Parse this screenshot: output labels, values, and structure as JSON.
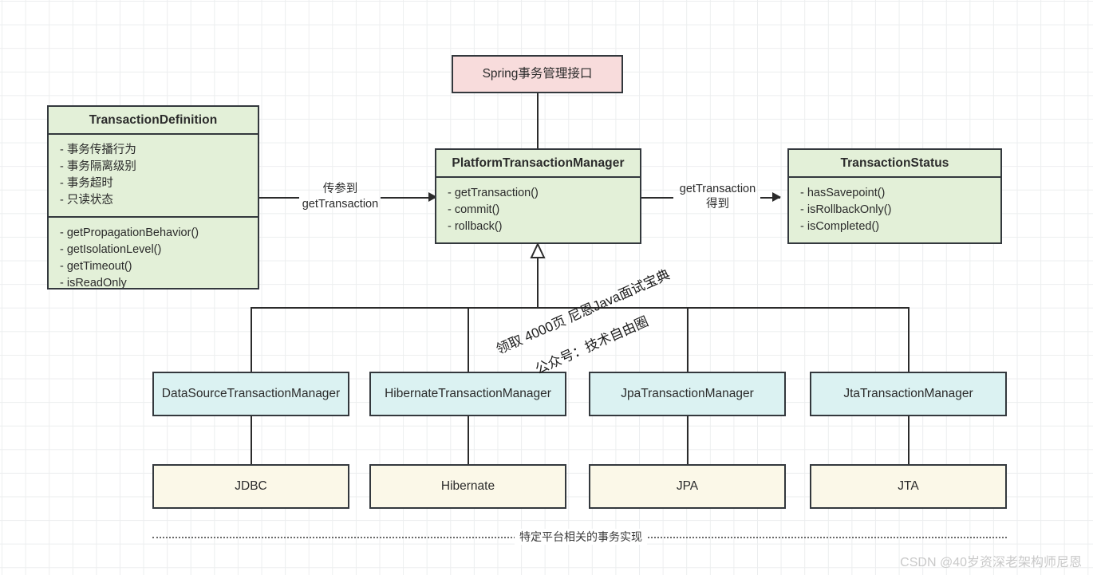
{
  "diagram": {
    "title_node": {
      "label": "Spring事务管理接口"
    },
    "definition": {
      "title": "TransactionDefinition",
      "attributes": [
        "- 事务传播行为",
        "- 事务隔离级别",
        "- 事务超时",
        "- 只读状态"
      ],
      "methods": [
        "- getPropagationBehavior()",
        "- getIsolationLevel()",
        "- getTimeout()",
        "- isReadOnly"
      ]
    },
    "manager": {
      "title": "PlatformTransactionManager",
      "methods": [
        "- getTransaction()",
        "- commit()",
        "- rollback()"
      ]
    },
    "status": {
      "title": "TransactionStatus",
      "methods": [
        "- hasSavepoint()",
        "- isRollbackOnly()",
        "- isCompleted()"
      ]
    },
    "edges": {
      "left_label_line1": "传参到",
      "left_label_line2": "getTransaction",
      "right_label_line1": "getTransaction",
      "right_label_line2": "得到"
    },
    "implementations": [
      {
        "name": "DataSourceTransactionManager",
        "tech": "JDBC"
      },
      {
        "name": "HibernateTransactionManager",
        "tech": "Hibernate"
      },
      {
        "name": "JpaTransactionManager",
        "tech": "JPA"
      },
      {
        "name": "JtaTransactionManager",
        "tech": "JTA"
      }
    ],
    "footer_note": "特定平台相关的事务实现",
    "watermarks": {
      "line1": "领取 4000页 尼恩Java面试宝典",
      "line2": "公众号：技术自由圈",
      "csdn": "CSDN @40岁资深老架构师尼恩"
    },
    "colors": {
      "green": "#e3f0d8",
      "pink": "#f8dcdc",
      "cyan": "#dbf2f2",
      "cream": "#fbf8e8",
      "stroke": "#33383d"
    }
  }
}
